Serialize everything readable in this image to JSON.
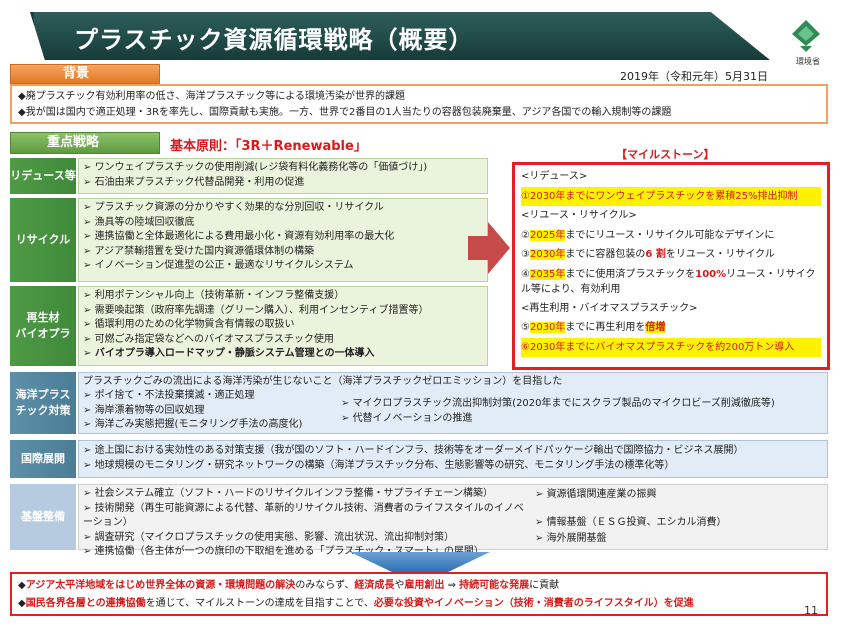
{
  "title": "プラスチック資源循環戦略（概要）",
  "logo_label": "環境省",
  "date": "2019年（令和元年）5月31日",
  "background": {
    "tab": "背景",
    "lines": [
      "廃プラスチック有効利用率の低さ、海洋プラスチック等による環境汚染が世界的課題",
      "我が国は国内で適正処理・3Rを率先し、国際貢献も実施。一方、世界で2番目の1人当たりの容器包装廃棄量、アジア各国での輸入規制等の課題"
    ]
  },
  "strategy": {
    "tab": "重点戦略",
    "principle": "基本原則：「3R＋Renewable」"
  },
  "rows": {
    "reduce": {
      "label": "リデュース等",
      "items": [
        "ワンウェイプラスチックの使用削減(レジ袋有料化義務化等の「価値づけ」)",
        "石油由来プラスチック代替品開発・利用の促進"
      ]
    },
    "recycle": {
      "label": "リサイクル",
      "items": [
        "プラスチック資源の分かりやすく効果的な分別回収・リサイクル",
        "漁具等の陸域回収徹底",
        "連携協働と全体最適化による費用最小化・資源有効利用率の最大化",
        "アジア禁輸措置を受けた国内資源循環体制の構築",
        "イノベーション促進型の公正・最適なリサイクルシステム"
      ]
    },
    "renewable": {
      "label_line1": "再生材",
      "label_line2": "バイオプラ",
      "items": [
        "利用ポテンシャル向上（技術革新・インフラ整備支援）",
        "需要喚起策（政府率先調達（グリーン購入）、利用インセンティブ措置等）",
        "循環利用のための化学物質含有情報の取扱い",
        "可燃ごみ指定袋などへのバイオマスプラスチック使用",
        "バイオプラ導入ロードマップ・静脈システム管理との一体導入"
      ]
    },
    "ocean": {
      "label_line1": "海洋プラス",
      "label_line2": "チック対策",
      "intro": "プラスチックごみの流出による海洋汚染が生じないこと（海洋プラスチックゼロエミッション）を目指した",
      "left_items": [
        "ポイ捨て・不法投棄撲滅・適正処理",
        "海岸漂着物等の回収処理",
        "海洋ごみ実態把握(モニタリング手法の高度化)"
      ],
      "right_items": [
        "マイクロプラスチック流出抑制対策(2020年までにスクラブ製品のマイクロビーズ削減徹底等)",
        "代替イノベーションの推進"
      ]
    },
    "intl": {
      "label": "国際展開",
      "items": [
        "途上国における実効性のある対策支援（我が国のソフト・ハードインフラ、技術等をオーダーメイドパッケージ輸出で国際協力・ビジネス展開）",
        "地球規模のモニタリング・研究ネットワークの構築（海洋プラスチック分布、生態影響等の研究、モニタリング手法の標準化等）"
      ]
    },
    "base": {
      "label": "基盤整備",
      "left_items": [
        "社会システム確立（ソフト・ハードのリサイクルインフラ整備・サプライチェーン構築）",
        "技術開発（再生可能資源による代替、革新的リサイクル技術、消費者のライフスタイルのイノベーション）",
        "調査研究（マイクロプラスチックの使用実態、影響、流出状況、流出抑制対策）",
        "連携協働（各主体が一つの旗印の下取組を進める「プラスチック・スマート」の展開）"
      ],
      "right_items": [
        "資源循環関連産業の振興",
        "情報基盤（ＥＳＧ投資、エシカル消費）",
        "海外展開基盤"
      ]
    }
  },
  "milestones": {
    "title": "【マイルストーン】",
    "h_reduce": "<リデュース>",
    "m1": "①2030年までにワンウェイプラスチックを累積25%排出抑制",
    "h_reuse": "<リユース・リサイクル>",
    "m2_pre": "②",
    "m2_year": "2025年",
    "m2_post": "までにリユース・リサイクル可能なデザインに",
    "m3_pre": "③",
    "m3_year": "2030年",
    "m3_mid": "までに容器包装の",
    "m3_val": "6 割",
    "m3_post": "をリユース・リサイクル",
    "m4_pre": "④",
    "m4_year": "2035年",
    "m4_mid": "までに使用済プラスチックを",
    "m4_val": "100%",
    "m4_post": "リユース・リサイクル等により、有効利用",
    "h_renew": "<再生利用・バイオマスプラスチック>",
    "m5_pre": "⑤",
    "m5_year": "2030年",
    "m5_mid": "までに再生利用を",
    "m5_val": "倍増",
    "m6": "⑥2030年までにバイオマスプラスチックを約200万トン導入"
  },
  "bottom": {
    "l1_a": "アジア太平洋地域をはじめ世界全体の資源・環境問題の解決",
    "l1_b": "のみならず、",
    "l1_c": "経済成長",
    "l1_d": "や",
    "l1_e": "雇用創出",
    "l1_f": " ⇒ ",
    "l1_g": "持続可能な発展",
    "l1_h": "に貢献",
    "l2_a": "国民各界各層との連携協働",
    "l2_b": "を通じて、マイルストーンの達成を目指すことで、",
    "l2_c": "必要な投資やイノベーション（技術・消費者のライフスタイル）を促進"
  },
  "page_number": "11",
  "colors": {
    "accent_red": "#d81a1a",
    "green": "#4f9a45",
    "title_bg": "#1f4a47",
    "orange": "#e07a27"
  }
}
